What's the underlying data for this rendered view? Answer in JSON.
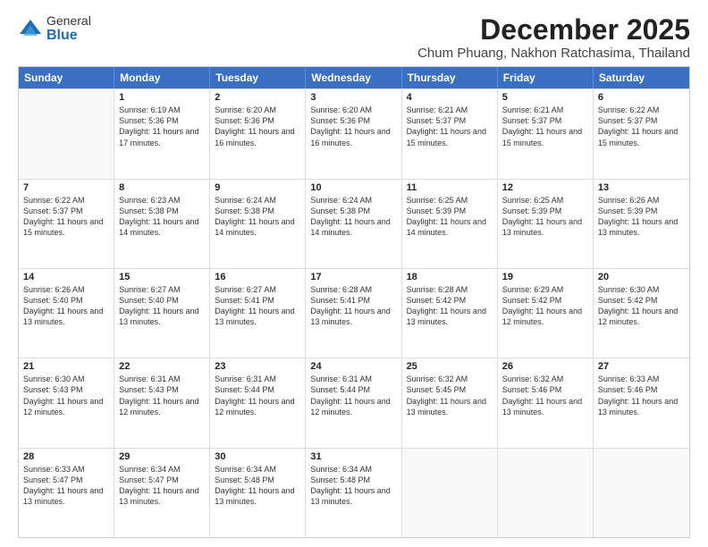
{
  "logo": {
    "general": "General",
    "blue": "Blue"
  },
  "title": {
    "month": "December 2025",
    "location": "Chum Phuang, Nakhon Ratchasima, Thailand"
  },
  "header_days": [
    "Sunday",
    "Monday",
    "Tuesday",
    "Wednesday",
    "Thursday",
    "Friday",
    "Saturday"
  ],
  "weeks": [
    [
      {
        "day": "",
        "sunrise": "",
        "sunset": "",
        "daylight": ""
      },
      {
        "day": "1",
        "sunrise": "Sunrise: 6:19 AM",
        "sunset": "Sunset: 5:36 PM",
        "daylight": "Daylight: 11 hours and 17 minutes."
      },
      {
        "day": "2",
        "sunrise": "Sunrise: 6:20 AM",
        "sunset": "Sunset: 5:36 PM",
        "daylight": "Daylight: 11 hours and 16 minutes."
      },
      {
        "day": "3",
        "sunrise": "Sunrise: 6:20 AM",
        "sunset": "Sunset: 5:36 PM",
        "daylight": "Daylight: 11 hours and 16 minutes."
      },
      {
        "day": "4",
        "sunrise": "Sunrise: 6:21 AM",
        "sunset": "Sunset: 5:37 PM",
        "daylight": "Daylight: 11 hours and 15 minutes."
      },
      {
        "day": "5",
        "sunrise": "Sunrise: 6:21 AM",
        "sunset": "Sunset: 5:37 PM",
        "daylight": "Daylight: 11 hours and 15 minutes."
      },
      {
        "day": "6",
        "sunrise": "Sunrise: 6:22 AM",
        "sunset": "Sunset: 5:37 PM",
        "daylight": "Daylight: 11 hours and 15 minutes."
      }
    ],
    [
      {
        "day": "7",
        "sunrise": "Sunrise: 6:22 AM",
        "sunset": "Sunset: 5:37 PM",
        "daylight": "Daylight: 11 hours and 15 minutes."
      },
      {
        "day": "8",
        "sunrise": "Sunrise: 6:23 AM",
        "sunset": "Sunset: 5:38 PM",
        "daylight": "Daylight: 11 hours and 14 minutes."
      },
      {
        "day": "9",
        "sunrise": "Sunrise: 6:24 AM",
        "sunset": "Sunset: 5:38 PM",
        "daylight": "Daylight: 11 hours and 14 minutes."
      },
      {
        "day": "10",
        "sunrise": "Sunrise: 6:24 AM",
        "sunset": "Sunset: 5:38 PM",
        "daylight": "Daylight: 11 hours and 14 minutes."
      },
      {
        "day": "11",
        "sunrise": "Sunrise: 6:25 AM",
        "sunset": "Sunset: 5:39 PM",
        "daylight": "Daylight: 11 hours and 14 minutes."
      },
      {
        "day": "12",
        "sunrise": "Sunrise: 6:25 AM",
        "sunset": "Sunset: 5:39 PM",
        "daylight": "Daylight: 11 hours and 13 minutes."
      },
      {
        "day": "13",
        "sunrise": "Sunrise: 6:26 AM",
        "sunset": "Sunset: 5:39 PM",
        "daylight": "Daylight: 11 hours and 13 minutes."
      }
    ],
    [
      {
        "day": "14",
        "sunrise": "Sunrise: 6:26 AM",
        "sunset": "Sunset: 5:40 PM",
        "daylight": "Daylight: 11 hours and 13 minutes."
      },
      {
        "day": "15",
        "sunrise": "Sunrise: 6:27 AM",
        "sunset": "Sunset: 5:40 PM",
        "daylight": "Daylight: 11 hours and 13 minutes."
      },
      {
        "day": "16",
        "sunrise": "Sunrise: 6:27 AM",
        "sunset": "Sunset: 5:41 PM",
        "daylight": "Daylight: 11 hours and 13 minutes."
      },
      {
        "day": "17",
        "sunrise": "Sunrise: 6:28 AM",
        "sunset": "Sunset: 5:41 PM",
        "daylight": "Daylight: 11 hours and 13 minutes."
      },
      {
        "day": "18",
        "sunrise": "Sunrise: 6:28 AM",
        "sunset": "Sunset: 5:42 PM",
        "daylight": "Daylight: 11 hours and 13 minutes."
      },
      {
        "day": "19",
        "sunrise": "Sunrise: 6:29 AM",
        "sunset": "Sunset: 5:42 PM",
        "daylight": "Daylight: 11 hours and 12 minutes."
      },
      {
        "day": "20",
        "sunrise": "Sunrise: 6:30 AM",
        "sunset": "Sunset: 5:42 PM",
        "daylight": "Daylight: 11 hours and 12 minutes."
      }
    ],
    [
      {
        "day": "21",
        "sunrise": "Sunrise: 6:30 AM",
        "sunset": "Sunset: 5:43 PM",
        "daylight": "Daylight: 11 hours and 12 minutes."
      },
      {
        "day": "22",
        "sunrise": "Sunrise: 6:31 AM",
        "sunset": "Sunset: 5:43 PM",
        "daylight": "Daylight: 11 hours and 12 minutes."
      },
      {
        "day": "23",
        "sunrise": "Sunrise: 6:31 AM",
        "sunset": "Sunset: 5:44 PM",
        "daylight": "Daylight: 11 hours and 12 minutes."
      },
      {
        "day": "24",
        "sunrise": "Sunrise: 6:31 AM",
        "sunset": "Sunset: 5:44 PM",
        "daylight": "Daylight: 11 hours and 12 minutes."
      },
      {
        "day": "25",
        "sunrise": "Sunrise: 6:32 AM",
        "sunset": "Sunset: 5:45 PM",
        "daylight": "Daylight: 11 hours and 13 minutes."
      },
      {
        "day": "26",
        "sunrise": "Sunrise: 6:32 AM",
        "sunset": "Sunset: 5:46 PM",
        "daylight": "Daylight: 11 hours and 13 minutes."
      },
      {
        "day": "27",
        "sunrise": "Sunrise: 6:33 AM",
        "sunset": "Sunset: 5:46 PM",
        "daylight": "Daylight: 11 hours and 13 minutes."
      }
    ],
    [
      {
        "day": "28",
        "sunrise": "Sunrise: 6:33 AM",
        "sunset": "Sunset: 5:47 PM",
        "daylight": "Daylight: 11 hours and 13 minutes."
      },
      {
        "day": "29",
        "sunrise": "Sunrise: 6:34 AM",
        "sunset": "Sunset: 5:47 PM",
        "daylight": "Daylight: 11 hours and 13 minutes."
      },
      {
        "day": "30",
        "sunrise": "Sunrise: 6:34 AM",
        "sunset": "Sunset: 5:48 PM",
        "daylight": "Daylight: 11 hours and 13 minutes."
      },
      {
        "day": "31",
        "sunrise": "Sunrise: 6:34 AM",
        "sunset": "Sunset: 5:48 PM",
        "daylight": "Daylight: 11 hours and 13 minutes."
      },
      {
        "day": "",
        "sunrise": "",
        "sunset": "",
        "daylight": ""
      },
      {
        "day": "",
        "sunrise": "",
        "sunset": "",
        "daylight": ""
      },
      {
        "day": "",
        "sunrise": "",
        "sunset": "",
        "daylight": ""
      }
    ]
  ]
}
